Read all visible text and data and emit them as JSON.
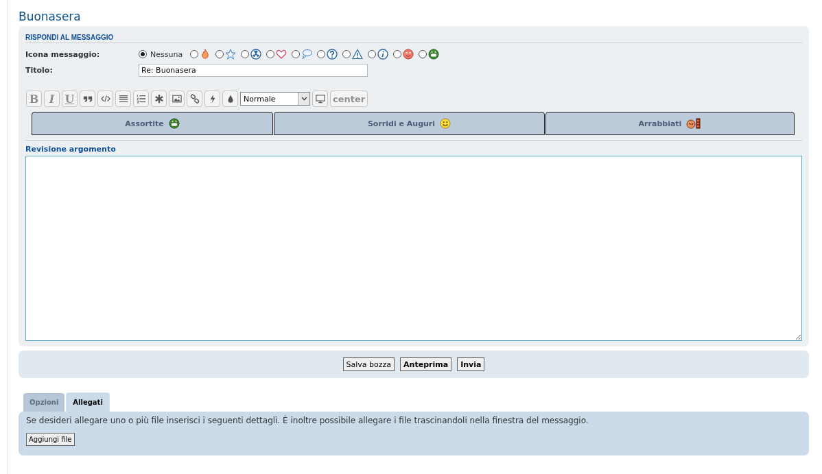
{
  "title": "Buonasera",
  "form": {
    "heading": "RISPONDI AL MESSAGGIO",
    "icon_label": "Icona messaggio:",
    "icons": [
      {
        "kind": "none",
        "label": "Nessuna",
        "selected": true
      },
      {
        "kind": "fire",
        "selected": false
      },
      {
        "kind": "star",
        "selected": false
      },
      {
        "kind": "radiation",
        "selected": false
      },
      {
        "kind": "heart",
        "selected": false
      },
      {
        "kind": "speech",
        "selected": false
      },
      {
        "kind": "question",
        "selected": false
      },
      {
        "kind": "warning",
        "selected": false
      },
      {
        "kind": "info",
        "selected": false
      },
      {
        "kind": "wink",
        "selected": false
      },
      {
        "kind": "grin",
        "selected": false
      }
    ],
    "title_label": "Titolo:",
    "title_value": "Re: Buonasera",
    "toolbar": [
      {
        "kind": "bold",
        "text": "B"
      },
      {
        "kind": "italic",
        "text": "I"
      },
      {
        "kind": "underline",
        "text": "U"
      },
      {
        "kind": "quote"
      },
      {
        "kind": "code"
      },
      {
        "kind": "list"
      },
      {
        "kind": "numlist"
      },
      {
        "kind": "asterisk"
      },
      {
        "kind": "image"
      },
      {
        "kind": "link"
      },
      {
        "kind": "flash"
      },
      {
        "kind": "drop"
      },
      {
        "kind": "select",
        "text": "Normale"
      },
      {
        "kind": "monitor"
      },
      {
        "kind": "word",
        "text": "center"
      }
    ],
    "smiley_tabs": [
      {
        "label": "Assortite",
        "kind": "grin"
      },
      {
        "label": "Sorridi e Auguri",
        "kind": "smile"
      },
      {
        "label": "Arrabbiati",
        "kind": "angry"
      }
    ],
    "body_label": "Revisione argomento"
  },
  "actions": [
    {
      "label": "Salva bozza",
      "bold": false
    },
    {
      "label": "Anteprima",
      "bold": true
    },
    {
      "label": "Invia",
      "bold": true
    }
  ],
  "tabs": [
    {
      "label": "Opzioni",
      "selected": false
    },
    {
      "label": "Allegati",
      "selected": true
    }
  ],
  "attachments": {
    "text": "Se desideri allegare uno o più file inserisci i seguenti dettagli. È inoltre possibile allegare i file trascinandoli nella finestra del messaggio.",
    "button": "Aggiungi file"
  }
}
